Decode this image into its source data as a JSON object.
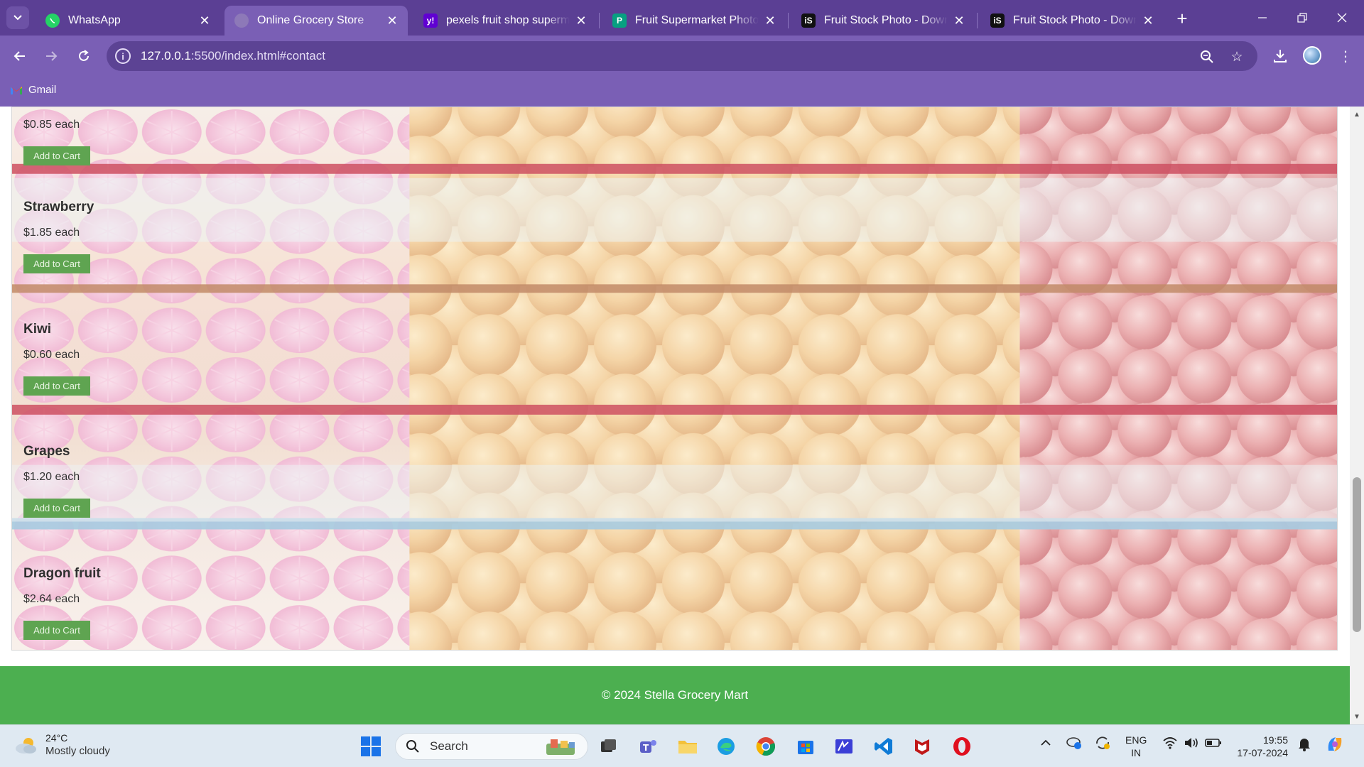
{
  "browser": {
    "tabs": [
      {
        "title": "WhatsApp",
        "icon": "whatsapp-icon"
      },
      {
        "title": "Online Grocery Store",
        "icon": "globe-icon",
        "active": true
      },
      {
        "title": "pexels fruit shop superma",
        "icon": "yahoo-icon"
      },
      {
        "title": "Fruit Supermarket Photos, I",
        "icon": "pexels-icon"
      },
      {
        "title": "Fruit Stock Photo - Downlo",
        "icon": "istock-icon"
      },
      {
        "title": "Fruit Stock Photo - Downlo",
        "icon": "istock-icon"
      }
    ],
    "url_host": "127.0.0.1",
    "url_rest": ":5500/index.html#contact",
    "bookmarks": [
      {
        "label": "Gmail",
        "icon": "gmail-icon"
      }
    ]
  },
  "products": [
    {
      "name": "",
      "price": "$0.85 each",
      "button": "Add to Cart"
    },
    {
      "name": "Strawberry",
      "price": "$1.85 each",
      "button": "Add to Cart"
    },
    {
      "name": "Kiwi",
      "price": "$0.60 each",
      "button": "Add to Cart"
    },
    {
      "name": "Grapes",
      "price": "$1.20 each",
      "button": "Add to Cart"
    },
    {
      "name": "Dragon fruit",
      "price": "$2.64 each",
      "button": "Add to Cart"
    }
  ],
  "footer": {
    "text": "© 2024 Stella Grocery Mart"
  },
  "taskbar": {
    "weather_temp": "24°C",
    "weather_desc": "Mostly cloudy",
    "search_label": "Search",
    "lang_top": "ENG",
    "lang_bottom": "IN",
    "time": "19:55",
    "date": "17-07-2024"
  },
  "colors": {
    "tabbar": "#5b3f94",
    "toolbar": "#7a5fb5",
    "footer": "#4caf50",
    "button": "#5fa451"
  }
}
